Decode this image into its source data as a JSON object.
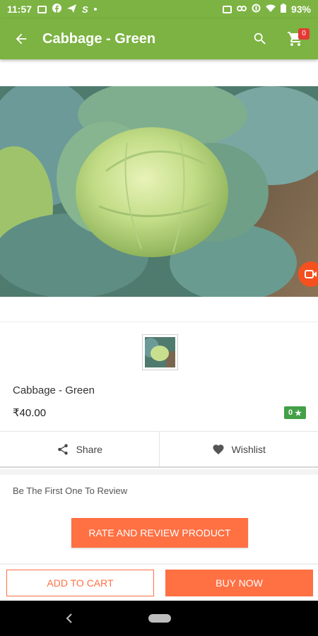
{
  "status_bar": {
    "time": "11:57",
    "battery": "93%",
    "left_icons": [
      "image-icon",
      "facebook-icon",
      "send-icon",
      "s-app-icon",
      "dot-icon"
    ],
    "right_icons": [
      "vibrate-icon",
      "link-icon",
      "data-saver-icon",
      "wifi-icon",
      "battery-icon"
    ]
  },
  "app_bar": {
    "title": "Cabbage - Green",
    "cart_count": "0",
    "background": "#7cb342"
  },
  "product": {
    "name": "Cabbage - Green",
    "price": "₹40.00",
    "rating": "0",
    "rating_icon": "star-icon"
  },
  "actions": {
    "share_label": "Share",
    "wishlist_label": "Wishlist"
  },
  "review": {
    "prompt": "Be The First One To Review",
    "button_label": "RATE AND REVIEW PRODUCT"
  },
  "bottom_bar": {
    "add_to_cart_label": "ADD TO CART",
    "buy_now_label": "BUY NOW",
    "accent": "#ff7043"
  }
}
